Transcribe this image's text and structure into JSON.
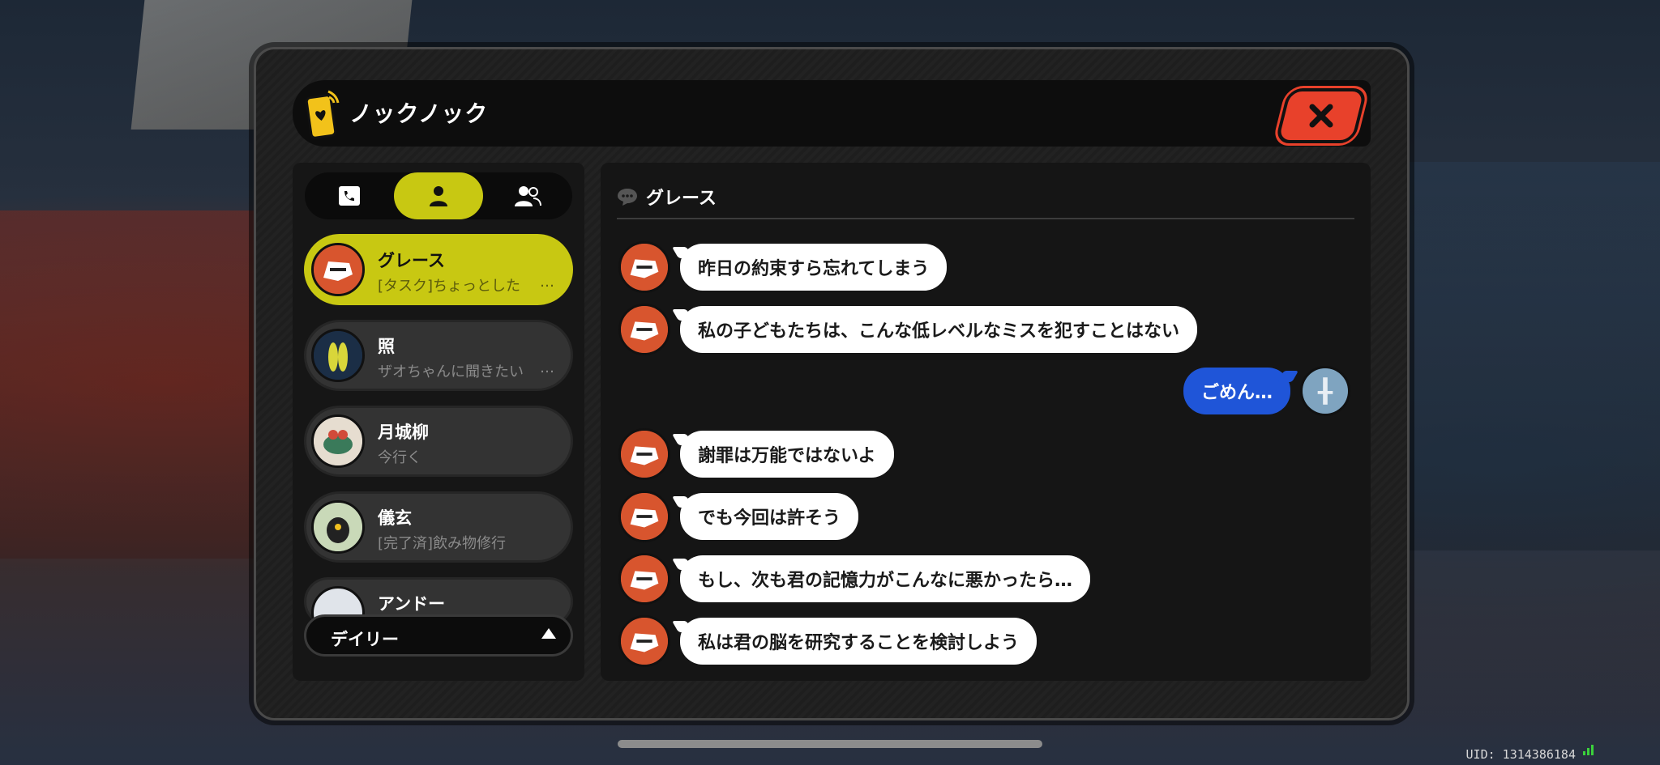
{
  "app": {
    "title": "ノックノック",
    "close_label": "✕"
  },
  "tabs": [
    {
      "name": "phone-tab",
      "icon": "phone-book-icon",
      "active": false
    },
    {
      "name": "person-tab",
      "icon": "person-icon",
      "active": true
    },
    {
      "name": "group-tab",
      "icon": "group-icon",
      "active": false
    }
  ],
  "contacts": [
    {
      "name": "グレース",
      "preview": "[タスク]ちょっとした",
      "more": "…",
      "selected": true
    },
    {
      "name": "照",
      "preview": "ザオちゃんに聞きたい",
      "more": "…",
      "selected": false
    },
    {
      "name": "月城柳",
      "preview": "今行く",
      "more": "",
      "selected": false
    },
    {
      "name": "儀玄",
      "preview": "[完了済]飲み物修行",
      "more": "",
      "selected": false
    },
    {
      "name": "アンドー",
      "preview": "",
      "more": "",
      "selected": false
    }
  ],
  "filter": {
    "label": "デイリー"
  },
  "chat": {
    "contact_name": "グレース",
    "messages": [
      {
        "from": "them",
        "text": "昨日の約束すら忘れてしまう"
      },
      {
        "from": "them",
        "text": "私の子どもたちは、こんな低レベルなミスを犯すことはない"
      },
      {
        "from": "me",
        "text": "ごめん…"
      },
      {
        "from": "them",
        "text": "謝罪は万能ではないよ"
      },
      {
        "from": "them",
        "text": "でも今回は許そう"
      },
      {
        "from": "them",
        "text": "もし、次も君の記憶力がこんなに悪かったら…"
      },
      {
        "from": "them",
        "text": "私は君の脳を研究することを検討しよう"
      }
    ]
  },
  "status": {
    "uid": "UID: 1314386184"
  },
  "colors": {
    "accent": "#c8c812",
    "close": "#e8412b",
    "my_bubble": "#1f55d8"
  }
}
